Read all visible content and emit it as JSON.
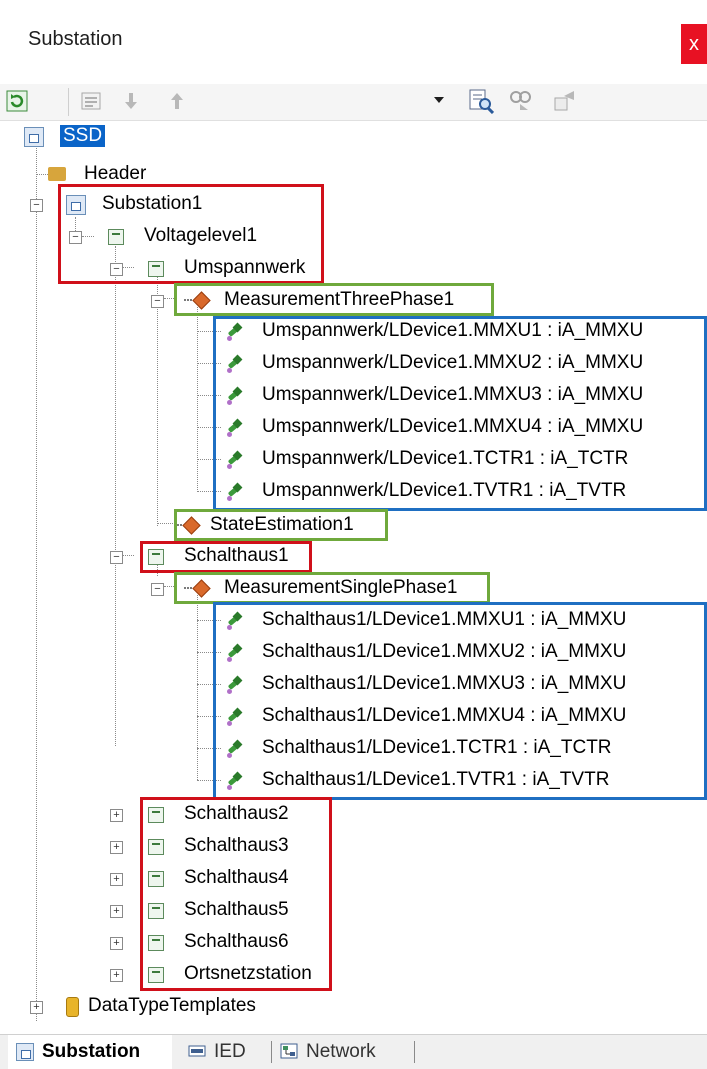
{
  "window": {
    "title": "Substation",
    "close": "x"
  },
  "toolbar": {
    "buttons": [
      {
        "name": "refresh-icon"
      },
      {
        "name": "list-icon"
      },
      {
        "name": "arrow-down-icon"
      },
      {
        "name": "arrow-up-icon"
      },
      {
        "name": "dropdown-arrow-icon"
      },
      {
        "name": "find-icon"
      },
      {
        "name": "find-next-icon"
      },
      {
        "name": "replace-icon"
      }
    ]
  },
  "tree": {
    "root": "SSD",
    "header": "Header",
    "substation": "Substation1",
    "voltagelevel": "Voltagelevel1",
    "bay1": "Umspannwerk",
    "fn1": "MeasurementThreePhase1",
    "fn1_items": [
      "Umspannwerk/LDevice1.MMXU1 : iA_MMXU",
      "Umspannwerk/LDevice1.MMXU2 : iA_MMXU",
      "Umspannwerk/LDevice1.MMXU3 : iA_MMXU",
      "Umspannwerk/LDevice1.MMXU4 : iA_MMXU",
      "Umspannwerk/LDevice1.TCTR1 : iA_TCTR",
      "Umspannwerk/LDevice1.TVTR1 : iA_TVTR"
    ],
    "fn2": "StateEstimation1",
    "bay2": "Schalthaus1",
    "fn3": "MeasurementSinglePhase1",
    "fn3_items": [
      "Schalthaus1/LDevice1.MMXU1 : iA_MMXU",
      "Schalthaus1/LDevice1.MMXU2 : iA_MMXU",
      "Schalthaus1/LDevice1.MMXU3 : iA_MMXU",
      "Schalthaus1/LDevice1.MMXU4 : iA_MMXU",
      "Schalthaus1/LDevice1.TCTR1 : iA_TCTR",
      "Schalthaus1/LDevice1.TVTR1 : iA_TVTR"
    ],
    "collapsed_bays": [
      "Schalthaus2",
      "Schalthaus3",
      "Schalthaus4",
      "Schalthaus5",
      "Schalthaus6",
      "Ortsnetzstation"
    ],
    "datatypes": "DataTypeTemplates",
    "expander_minus": "−",
    "expander_plus": "+"
  },
  "tabs": [
    {
      "label": "Substation",
      "active": true
    },
    {
      "label": "IED",
      "active": false
    },
    {
      "label": "Network",
      "active": false
    }
  ],
  "colors": {
    "red_box": "#d0101a",
    "green_box": "#6fa93c",
    "blue_box": "#1f6fc2",
    "selection": "#0a64c8"
  }
}
